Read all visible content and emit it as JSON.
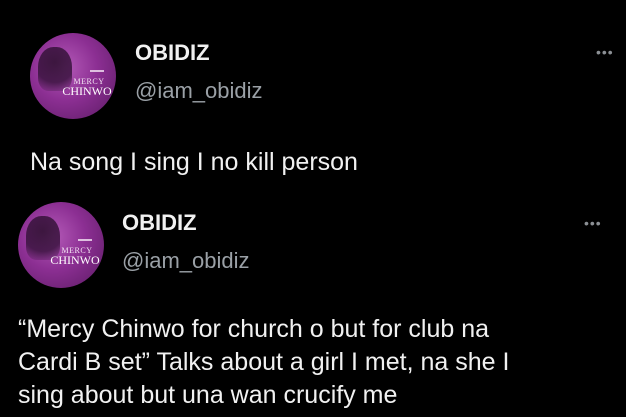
{
  "tweets": [
    {
      "avatar": {
        "line1": "MERCY",
        "line2": "CHINWO"
      },
      "name": "OBIDIZ",
      "handle": "@iam_obidiz",
      "more": "•••",
      "text": "Na song I sing I no kill person"
    },
    {
      "avatar": {
        "line1": "MERCY",
        "line2": "CHINWO"
      },
      "name": "OBIDIZ",
      "handle": "@iam_obidiz",
      "more": "•••",
      "text_lines": [
        "“Mercy Chinwo for church o but for club na",
        "Cardi B set”  Talks about a girl I met, na she I",
        "sing about but una wan crucify me"
      ]
    }
  ],
  "colors": {
    "background": "#000000",
    "text": "#f1f1f1",
    "handle": "#9aa0a6",
    "avatar": "#8c2f93"
  }
}
